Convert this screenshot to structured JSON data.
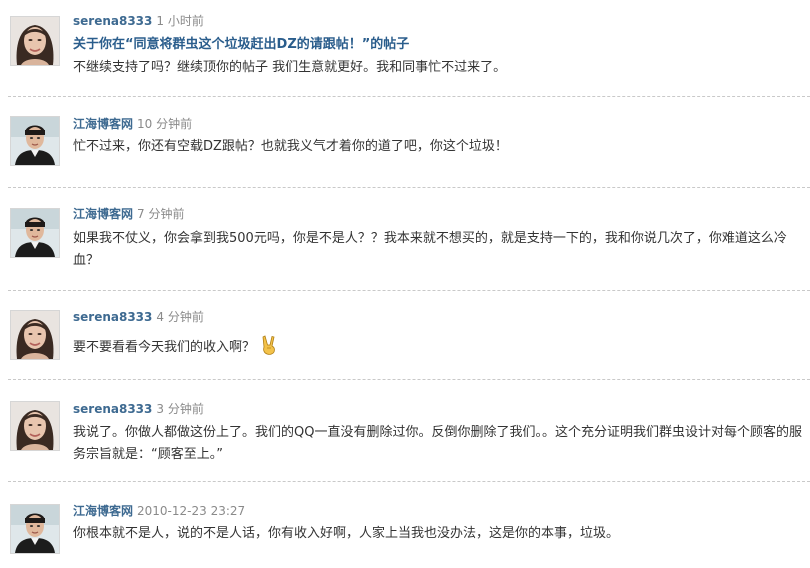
{
  "posts": [
    {
      "author": "serena8333",
      "time": "1 小时前",
      "avatar": "female-avatar",
      "title": "关于你在“同意将群虫这个垃圾赶出DZ的请跟帖！”的帖子",
      "body": "不继续支持了吗？继续顶你的帖子 我们生意就更好。我和同事忙不过来了。"
    },
    {
      "author": "江海博客网",
      "time": "10 分钟前",
      "avatar": "male-avatar",
      "body": "忙不过来，你还有空载DZ跟帖？也就我义气才着你的道了吧，你这个垃圾！"
    },
    {
      "author": "江海博客网",
      "time": "7 分钟前",
      "avatar": "male-avatar",
      "body": "如果我不仗义，你会拿到我500元吗，你是不是人？？我本来就不想买的，就是支持一下的，我和你说几次了，你难道这么冷血？"
    },
    {
      "author": "serena8333",
      "time": "4 分钟前",
      "avatar": "female-avatar",
      "body": "要不要看看今天我们的收入啊？",
      "emoji": "victory-hand-icon"
    },
    {
      "author": "serena8333",
      "time": "3 分钟前",
      "avatar": "female-avatar",
      "body": "我说了。你做人都做这份上了。我们的QQ一直没有删除过你。反倒你删除了我们。。这个充分证明我们群虫设计对每个顾客的服务宗旨就是：“顾客至上。”"
    },
    {
      "author": "江海博客网",
      "time": "2010-12-23 23:27",
      "avatar": "male-avatar",
      "body": "你根本就不是人，说的不是人话，你有收入好啊，人家上当我也没办法，这是你的本事，垃圾。"
    }
  ]
}
